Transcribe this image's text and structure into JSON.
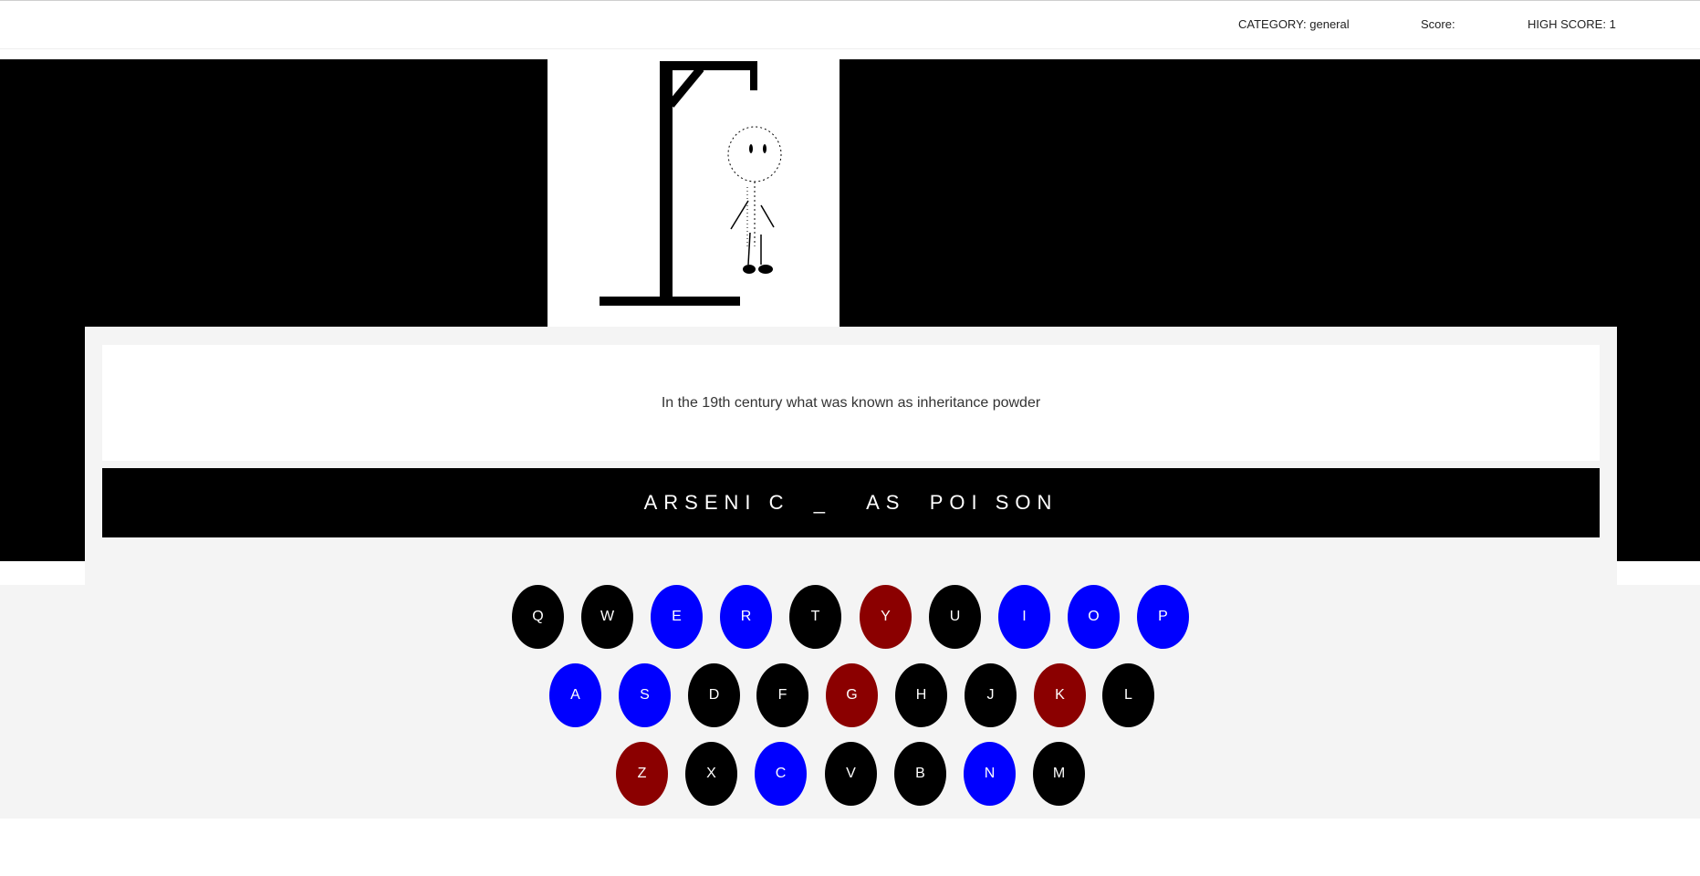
{
  "header": {
    "category": "CATEGORY: general",
    "score": "Score:",
    "high_score": "HIGH SCORE: 1"
  },
  "question": "In the 19th century what was known as inheritance powder",
  "answer_display": "ARSENI C  _   AS  POI SON",
  "colors": {
    "default_key": "#000000",
    "correct_key": "#0000ff",
    "wrong_key": "#8b0000"
  },
  "keyboard": {
    "rows": [
      [
        {
          "letter": "Q",
          "state": "unused"
        },
        {
          "letter": "W",
          "state": "unused"
        },
        {
          "letter": "E",
          "state": "correct"
        },
        {
          "letter": "R",
          "state": "correct"
        },
        {
          "letter": "T",
          "state": "unused"
        },
        {
          "letter": "Y",
          "state": "wrong"
        },
        {
          "letter": "U",
          "state": "unused"
        },
        {
          "letter": "I",
          "state": "correct"
        },
        {
          "letter": "O",
          "state": "correct"
        },
        {
          "letter": "P",
          "state": "correct"
        }
      ],
      [
        {
          "letter": "A",
          "state": "correct"
        },
        {
          "letter": "S",
          "state": "correct"
        },
        {
          "letter": "D",
          "state": "unused"
        },
        {
          "letter": "F",
          "state": "unused"
        },
        {
          "letter": "G",
          "state": "wrong"
        },
        {
          "letter": "H",
          "state": "unused"
        },
        {
          "letter": "J",
          "state": "unused"
        },
        {
          "letter": "K",
          "state": "wrong"
        },
        {
          "letter": "L",
          "state": "unused"
        }
      ],
      [
        {
          "letter": "Z",
          "state": "wrong"
        },
        {
          "letter": "X",
          "state": "unused"
        },
        {
          "letter": "C",
          "state": "correct"
        },
        {
          "letter": "V",
          "state": "unused"
        },
        {
          "letter": "B",
          "state": "unused"
        },
        {
          "letter": "N",
          "state": "correct"
        },
        {
          "letter": "M",
          "state": "unused"
        }
      ]
    ]
  }
}
